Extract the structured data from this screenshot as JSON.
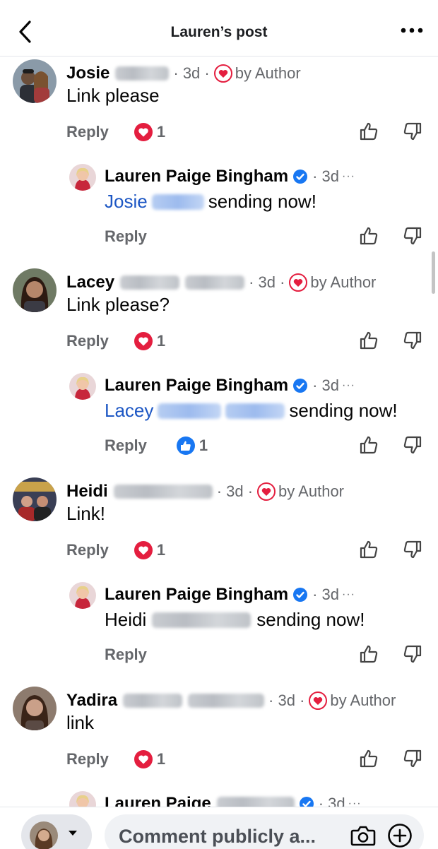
{
  "header": {
    "title": "Lauren’s post"
  },
  "comments": [
    {
      "name": "Josie",
      "time": "· 3d ·",
      "badge": "by Author",
      "text": "Link please",
      "reply": "Reply",
      "count": "1"
    },
    {
      "name": "Lauren Paige Bingham",
      "time": "· 3d",
      "more": "···",
      "mention": "Josie",
      "text": "sending now!",
      "reply": "Reply"
    },
    {
      "name": "Lacey",
      "time": "· 3d ·",
      "badge": "by Author",
      "text": "Link please?",
      "reply": "Reply",
      "count": "1"
    },
    {
      "name": "Lauren Paige Bingham",
      "time": "· 3d",
      "more": "···",
      "mention": "Lacey",
      "text": "sending now!",
      "reply": "Reply",
      "count": "1"
    },
    {
      "name": "Heidi",
      "time": "· 3d ·",
      "badge": "by Author",
      "text": "Link!",
      "reply": "Reply",
      "count": "1"
    },
    {
      "name": "Lauren Paige Bingham",
      "time": "· 3d",
      "more": "···",
      "mention": "Heidi",
      "text": "sending now!",
      "reply": "Reply"
    },
    {
      "name": "Yadira",
      "time": "· 3d ·",
      "badge": "by Author",
      "text": "link",
      "reply": "Reply",
      "count": "1"
    },
    {
      "name": "Lauren Paige",
      "time": "· 3d",
      "more": "···"
    }
  ],
  "composer": {
    "placeholder": "Comment publicly a..."
  },
  "colors": {
    "accent": "#1d57c4",
    "heart": "#e41e3f",
    "like": "#1877f2",
    "muted": "#65676b"
  }
}
